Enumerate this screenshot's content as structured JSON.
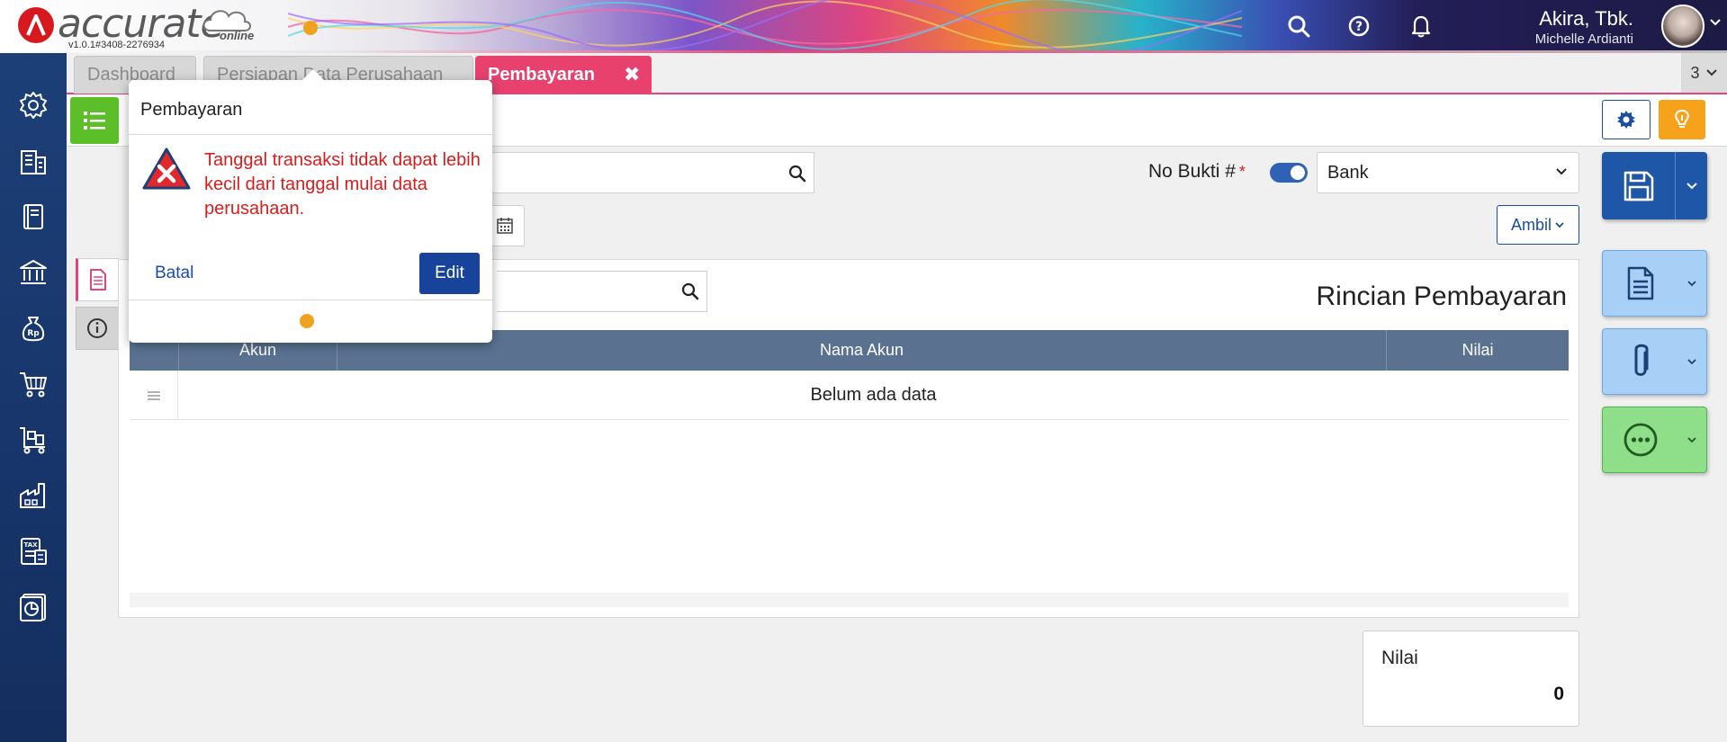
{
  "header": {
    "app_name": "accurate",
    "app_sub": "online",
    "version": "v1.0.1#3408-2276934",
    "company": "Akira, Tbk.",
    "user": "Michelle Ardianti"
  },
  "tabs": [
    {
      "label": "Dashboard",
      "active": false
    },
    {
      "label": "Persiapan Data Perusahaan",
      "active": false
    },
    {
      "label": "Pembayaran",
      "active": true
    }
  ],
  "tab_count": "3",
  "form": {
    "no_bukti_label": "No Bukti #",
    "required_mark": "*",
    "bank_value": "Bank",
    "ambil_label": "Ambil"
  },
  "detail": {
    "title": "Rincian Pembayaran",
    "columns": [
      "Akun",
      "Nama Akun",
      "Nilai"
    ],
    "empty_text": "Belum ada data"
  },
  "summary": {
    "label": "Nilai",
    "value": "0"
  },
  "popover": {
    "title": "Pembayaran",
    "message": "Tanggal transaksi tidak dapat lebih kecil dari tanggal mulai data perusahaan.",
    "cancel_label": "Batal",
    "edit_label": "Edit"
  },
  "sidebar_icons": [
    "gear-icon",
    "building-icon",
    "book-icon",
    "bank-icon",
    "money-bag-icon",
    "cart-icon",
    "shipping-icon",
    "factory-icon",
    "tax-icon",
    "report-icon"
  ],
  "colors": {
    "accent": "#e8416e",
    "primary": "#1e56a8",
    "sidebar": "#17356a",
    "error": "#d71e1e",
    "success": "#5cbf2a",
    "warning": "#f7a21b"
  }
}
